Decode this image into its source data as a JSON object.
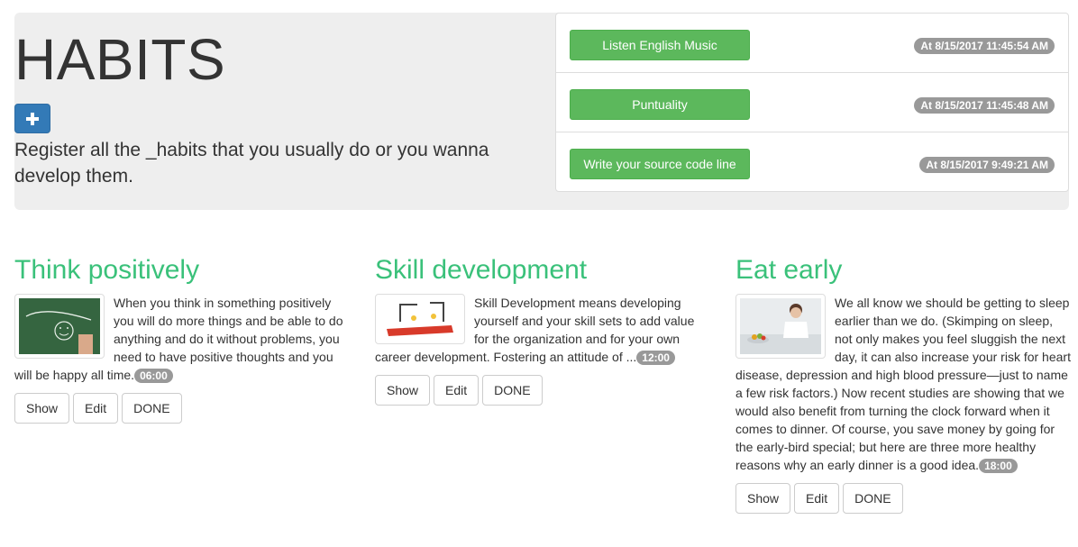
{
  "header": {
    "title": "HABITS",
    "add_button_icon": "plus-icon",
    "lead": "Register all the _habits that you usually do or you wanna develop them."
  },
  "recent": [
    {
      "label": "Listen English Music",
      "time": "At 8/15/2017 11:45:54 AM"
    },
    {
      "label": "Puntuality",
      "time": "At 8/15/2017 11:45:48 AM"
    },
    {
      "label": "Write your source code line",
      "time": "At 8/15/2017 9:49:21 AM"
    }
  ],
  "habits": [
    {
      "title": "Think positively",
      "image": "think-positive-chalkboard-image",
      "description": "When you think in something positively you will do more things and be able to do anything and do it without problems, you need to have positive thoughts and you will be happy all time.",
      "hour": "06:00",
      "show_label": "Show",
      "edit_label": "Edit",
      "done_label": "DONE"
    },
    {
      "title": "Skill development",
      "image": "skills-construction-image",
      "description": "Skill Development means developing yourself and your skill sets to add value for the organization and for your own career development. Fostering an attitude of ...",
      "hour": "12:00",
      "show_label": "Show",
      "edit_label": "Edit",
      "done_label": "DONE"
    },
    {
      "title": "Eat early",
      "image": "woman-eating-image",
      "description": "We all know we should be getting to sleep earlier than we do. (Skimping on sleep, not only makes you feel sluggish the next day, it can also increase your risk for heart disease, depression and high blood pressure—just to name a few risk factors.) Now recent studies are showing that we would also benefit from turning the clock forward when it comes to dinner. Of course, you save money by going for the early-bird special; but here are three more healthy reasons why an early dinner is a good idea.",
      "hour": "18:00",
      "show_label": "Show",
      "edit_label": "Edit",
      "done_label": "DONE"
    }
  ],
  "colors": {
    "jumbotron_bg": "#eeeeee",
    "primary": "#337ab7",
    "success": "#5cb85c",
    "habit_title": "#3ac17a",
    "badge": "#999999"
  }
}
